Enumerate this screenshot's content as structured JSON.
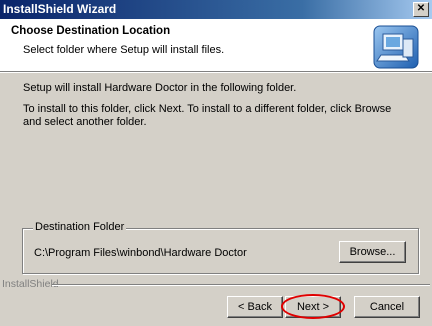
{
  "window": {
    "title": "InstallShield Wizard",
    "close_glyph": "✕"
  },
  "header": {
    "title": "Choose Destination Location",
    "subtitle": "Select folder where Setup will install files.",
    "icon": "computer-setup-icon"
  },
  "body": {
    "line1": "Setup will install Hardware Doctor in the following folder.",
    "line2": "To install to this folder, click Next. To install to a different folder, click Browse and select another folder."
  },
  "destination": {
    "legend": "Destination Folder",
    "path": "C:\\Program Files\\winbond\\Hardware Doctor",
    "browse_label": "Browse..."
  },
  "footer": {
    "brand": "InstallShield",
    "back_label": "< Back",
    "next_label": "Next >",
    "cancel_label": "Cancel"
  },
  "colors": {
    "title_start": "#0a246a",
    "title_end": "#a6caf0",
    "highlight": "#e00000"
  }
}
